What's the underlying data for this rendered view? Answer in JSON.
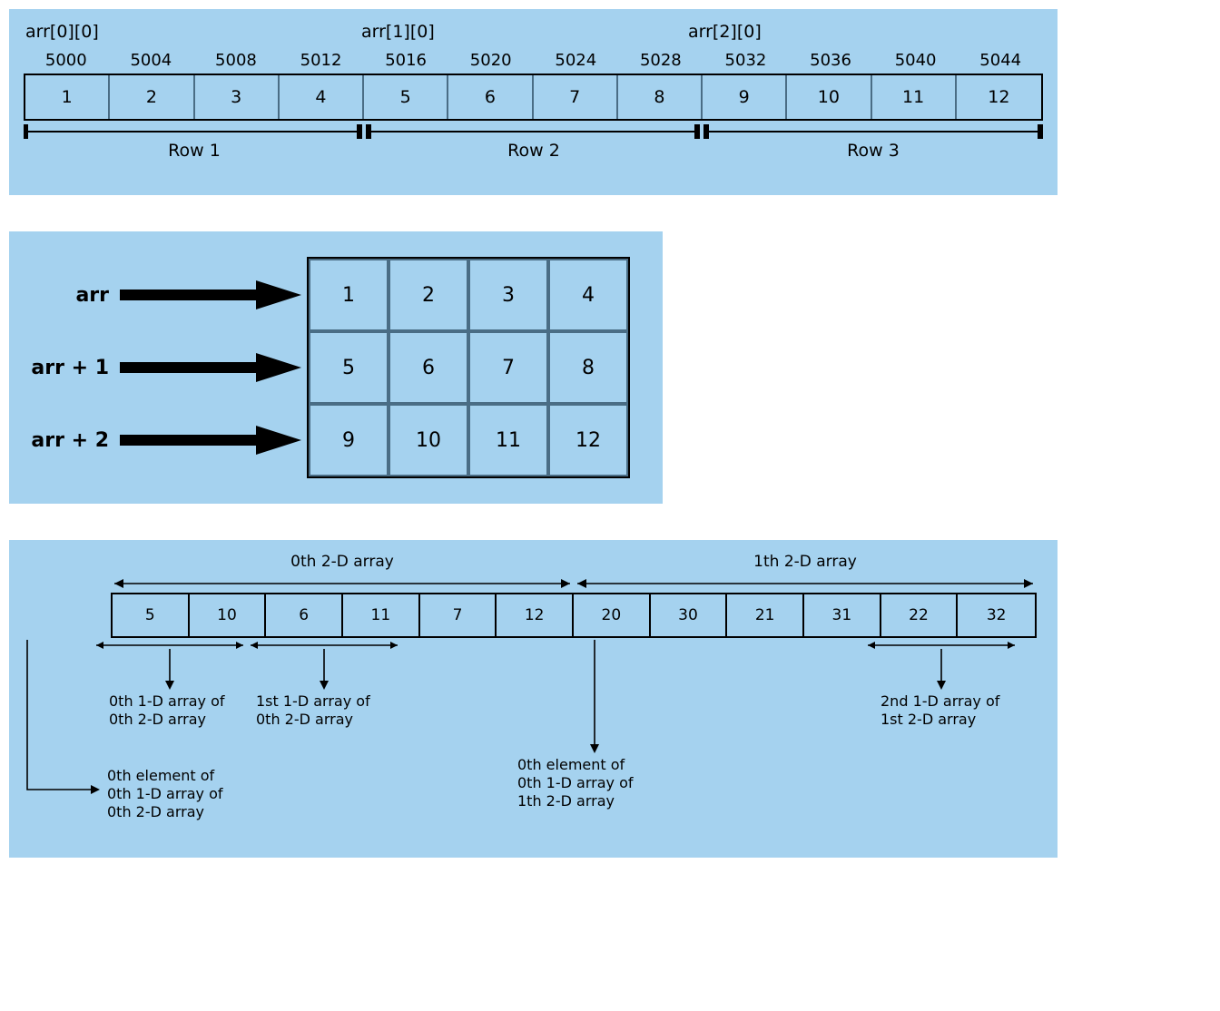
{
  "panel1": {
    "index_labels": [
      "arr[0][0]",
      "arr[1][0]",
      "arr[2][0]"
    ],
    "addresses": [
      "5000",
      "5004",
      "5008",
      "5012",
      "5016",
      "5020",
      "5024",
      "5028",
      "5032",
      "5036",
      "5040",
      "5044"
    ],
    "values": [
      "1",
      "2",
      "3",
      "4",
      "5",
      "6",
      "7",
      "8",
      "9",
      "10",
      "11",
      "12"
    ],
    "row_labels": [
      "Row 1",
      "Row 2",
      "Row 3"
    ]
  },
  "panel2": {
    "pointer_labels": [
      "arr",
      "arr + 1",
      "arr + 2"
    ],
    "grid": [
      [
        "1",
        "2",
        "3",
        "4"
      ],
      [
        "5",
        "6",
        "7",
        "8"
      ],
      [
        "9",
        "10",
        "11",
        "12"
      ]
    ]
  },
  "panel3": {
    "top_bracket_labels": [
      "0th 2-D array",
      "1th 2-D array"
    ],
    "values": [
      "5",
      "10",
      "6",
      "11",
      "7",
      "12",
      "20",
      "30",
      "21",
      "31",
      "22",
      "32"
    ],
    "callouts": {
      "a": "0th 1-D array of\n0th 2-D array",
      "b": "1st 1-D array of\n0th 2-D array",
      "c": "0th element of\n0th 1-D array of\n0th 2-D array",
      "d": "0th element of\n0th 1-D array of\n1th 2-D array",
      "e": "2nd 1-D array of\n1st 2-D array"
    }
  }
}
